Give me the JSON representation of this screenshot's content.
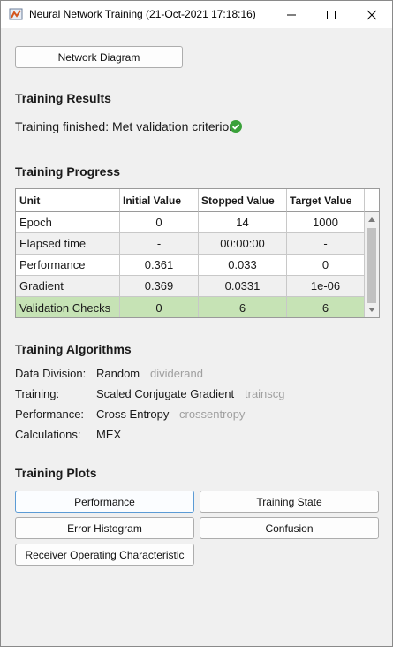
{
  "window": {
    "title": "Neural Network Training (21-Oct-2021 17:18:16)"
  },
  "network_diagram_button": "Network Diagram",
  "results": {
    "heading": "Training Results",
    "status_text": "Training finished: Met validation criterion",
    "status_icon": "check-circle-icon",
    "status_color": "#3aa13a"
  },
  "progress": {
    "heading": "Training Progress",
    "columns": [
      "Unit",
      "Initial Value",
      "Stopped Value",
      "Target Value"
    ],
    "rows": [
      [
        "Epoch",
        "0",
        "14",
        "1000"
      ],
      [
        "Elapsed time",
        "-",
        "00:00:00",
        "-"
      ],
      [
        "Performance",
        "0.361",
        "0.033",
        "0"
      ],
      [
        "Gradient",
        "0.369",
        "0.0331",
        "1e-06"
      ],
      [
        "Validation Checks",
        "0",
        "6",
        "6"
      ]
    ],
    "highlight_color": "#c6e3b5"
  },
  "algorithms": {
    "heading": "Training Algorithms",
    "items": [
      {
        "label": "Data Division:",
        "value": "Random",
        "func": "dividerand"
      },
      {
        "label": "Training:",
        "value": "Scaled Conjugate Gradient",
        "func": "trainscg"
      },
      {
        "label": "Performance:",
        "value": "Cross Entropy",
        "func": "crossentropy"
      },
      {
        "label": "Calculations:",
        "value": "MEX",
        "func": ""
      }
    ]
  },
  "plots": {
    "heading": "Training Plots",
    "buttons": [
      "Performance",
      "Training State",
      "Error Histogram",
      "Confusion",
      "Receiver Operating Characteristic"
    ]
  }
}
